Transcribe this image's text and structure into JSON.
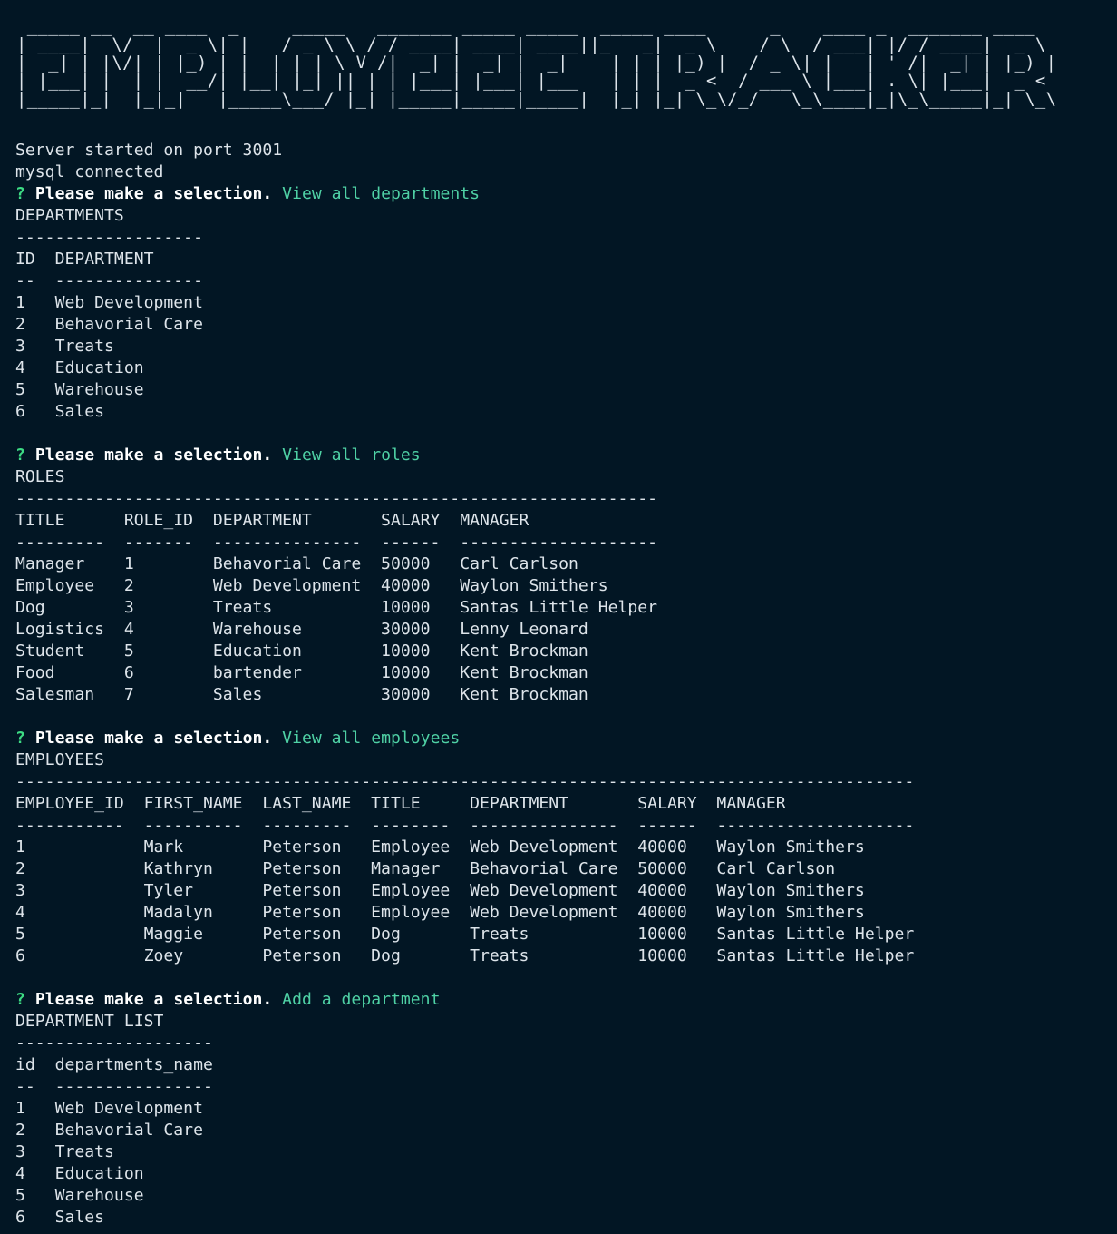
{
  "colors": {
    "background": "#021624",
    "text": "#dde4ea",
    "prompt_marker": "#3ddc84",
    "answer": "#4fd1a5"
  },
  "banner": {
    "text": "EMPLOYEE TRACKER",
    "ascii": [
      " _____ __  __ ____  _     _____   _______ _____ _____  _____ ____      _    ____ _  _______ ____  ",
      "| ____|  \\/  |  _ \\| |   / _ \\ \\ / / ____| ____| ____||_   _|  _ \\    / \\  / ___| |/ / ____|  _ \\ ",
      "|  _| | |\\/| | |_) | |  | | | \\ V /|  _| |  _| |  _|    | | | |_) |  / _ \\| |   | ' /|  _| | |_) |",
      "| |___| |  | |  __/| |__| |_| || | | |___| |___| |___   | | |  _ <  / ___ \\ |___| . \\| |___|  _ < ",
      "|_____|_|  |_|_|   |_____\\___/ |_| |_____|_____|_____|  |_| |_| \\_\\/_/   \\_\\____|_|\\_\\_____|_| \\_\\"
    ]
  },
  "startup": [
    "Server started on port 3001",
    "mysql connected"
  ],
  "prompt": {
    "marker": "?",
    "message": "Please make a selection."
  },
  "sections": [
    {
      "answer": "View all departments",
      "heading": "DEPARTMENTS",
      "rule": "-------------------",
      "header": "ID  DEPARTMENT",
      "underline": "--  ---------------",
      "rows": [
        "1   Web Development",
        "2   Behavorial Care",
        "3   Treats",
        "4   Education",
        "5   Warehouse",
        "6   Sales"
      ]
    },
    {
      "answer": "View all roles",
      "heading": "ROLES",
      "rule": "-----------------------------------------------------------------",
      "header": "TITLE      ROLE_ID  DEPARTMENT       SALARY  MANAGER",
      "underline": "---------  -------  ---------------  ------  --------------------",
      "rows": [
        "Manager    1        Behavorial Care  50000   Carl Carlson",
        "Employee   2        Web Development  40000   Waylon Smithers",
        "Dog        3        Treats           10000   Santas Little Helper",
        "Logistics  4        Warehouse        30000   Lenny Leonard",
        "Student    5        Education        10000   Kent Brockman",
        "Food       6        bartender        10000   Kent Brockman",
        "Salesman   7        Sales            30000   Kent Brockman"
      ]
    },
    {
      "answer": "View all employees",
      "heading": "EMPLOYEES",
      "rule": "-------------------------------------------------------------------------------------------",
      "header": "EMPLOYEE_ID  FIRST_NAME  LAST_NAME  TITLE     DEPARTMENT       SALARY  MANAGER",
      "underline": "-----------  ----------  ---------  --------  ---------------  ------  --------------------",
      "rows": [
        "1            Mark        Peterson   Employee  Web Development  40000   Waylon Smithers",
        "2            Kathryn     Peterson   Manager   Behavorial Care  50000   Carl Carlson",
        "3            Tyler       Peterson   Employee  Web Development  40000   Waylon Smithers",
        "4            Madalyn     Peterson   Employee  Web Development  40000   Waylon Smithers",
        "5            Maggie      Peterson   Dog       Treats           10000   Santas Little Helper",
        "6            Zoey        Peterson   Dog       Treats           10000   Santas Little Helper"
      ]
    },
    {
      "answer": "Add a department",
      "heading": "DEPARTMENT LIST",
      "rule": "--------------------",
      "header": "id  departments_name",
      "underline": "--  ----------------",
      "rows": [
        "1   Web Development",
        "2   Behavorial Care",
        "3   Treats",
        "4   Education",
        "5   Warehouse",
        "6   Sales"
      ]
    }
  ]
}
